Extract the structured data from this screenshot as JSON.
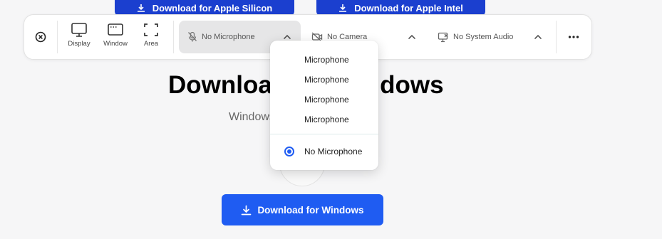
{
  "page": {
    "apple_silicon_button": "Download for Apple Silicon",
    "apple_intel_button": "Download for Apple Intel",
    "heading": "Download for Windows",
    "subtitle": "Windows",
    "windows_button": "Download for Windows",
    "accent": "#1f5cf2"
  },
  "toolbar": {
    "close_icon": "close-circle-icon",
    "modes": [
      {
        "label": "Display",
        "icon": "monitor-icon"
      },
      {
        "label": "Window",
        "icon": "window-icon"
      },
      {
        "label": "Area",
        "icon": "crop-area-icon"
      }
    ],
    "microphone": {
      "label": "No Microphone",
      "icon": "mic-off-icon"
    },
    "camera": {
      "label": "No Camera",
      "icon": "camera-off-icon"
    },
    "system_audio": {
      "label": "No System Audio",
      "icon": "speaker-off-icon"
    },
    "more_icon": "more-dots-icon"
  },
  "mic_dropdown": {
    "options": [
      "Microphone",
      "Microphone",
      "Microphone",
      "Microphone"
    ],
    "selected": "No Microphone"
  }
}
